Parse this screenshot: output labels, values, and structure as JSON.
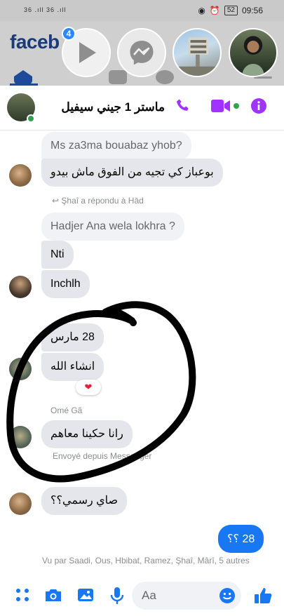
{
  "status_bar": {
    "signal": "36 .ıll 36 .ıll",
    "battery": "52",
    "time": "09:56"
  },
  "background": {
    "app_name": "faceb"
  },
  "chat_heads": {
    "badge_count": "4"
  },
  "header": {
    "title": "ماستر 1 جيني سيفيل",
    "icons": [
      "phone-icon",
      "video-icon",
      "info-icon"
    ],
    "accent_color": "#a033ff"
  },
  "messages": {
    "m1": "Ms za3ma bouabaz yhob?",
    "m2": "بوعباز كي تجيه من الفوق ماش بيدو",
    "reply_meta": "Şhaî a répondu à Hād",
    "m3": "Hadjer Ana wela lokhra ?",
    "m4": "Nti",
    "m5": "Inchlh",
    "m6": "28 مارس",
    "m7": "انشاء الله",
    "reaction": "❤",
    "sender_name": "Omé Gâ",
    "m8": "رانا حكينا معاهم",
    "sent_via": "Envoyé depuis Messenger",
    "m9": "صاي رسمي؟؟",
    "out1": "28 ؟؟",
    "seen_by": "Vu par Saadi, Ous, Hbibat, Ramez, Şhaî, Mârî, 5 autres"
  },
  "composer": {
    "placeholder": "Aa",
    "accent_color": "#1877f2"
  }
}
